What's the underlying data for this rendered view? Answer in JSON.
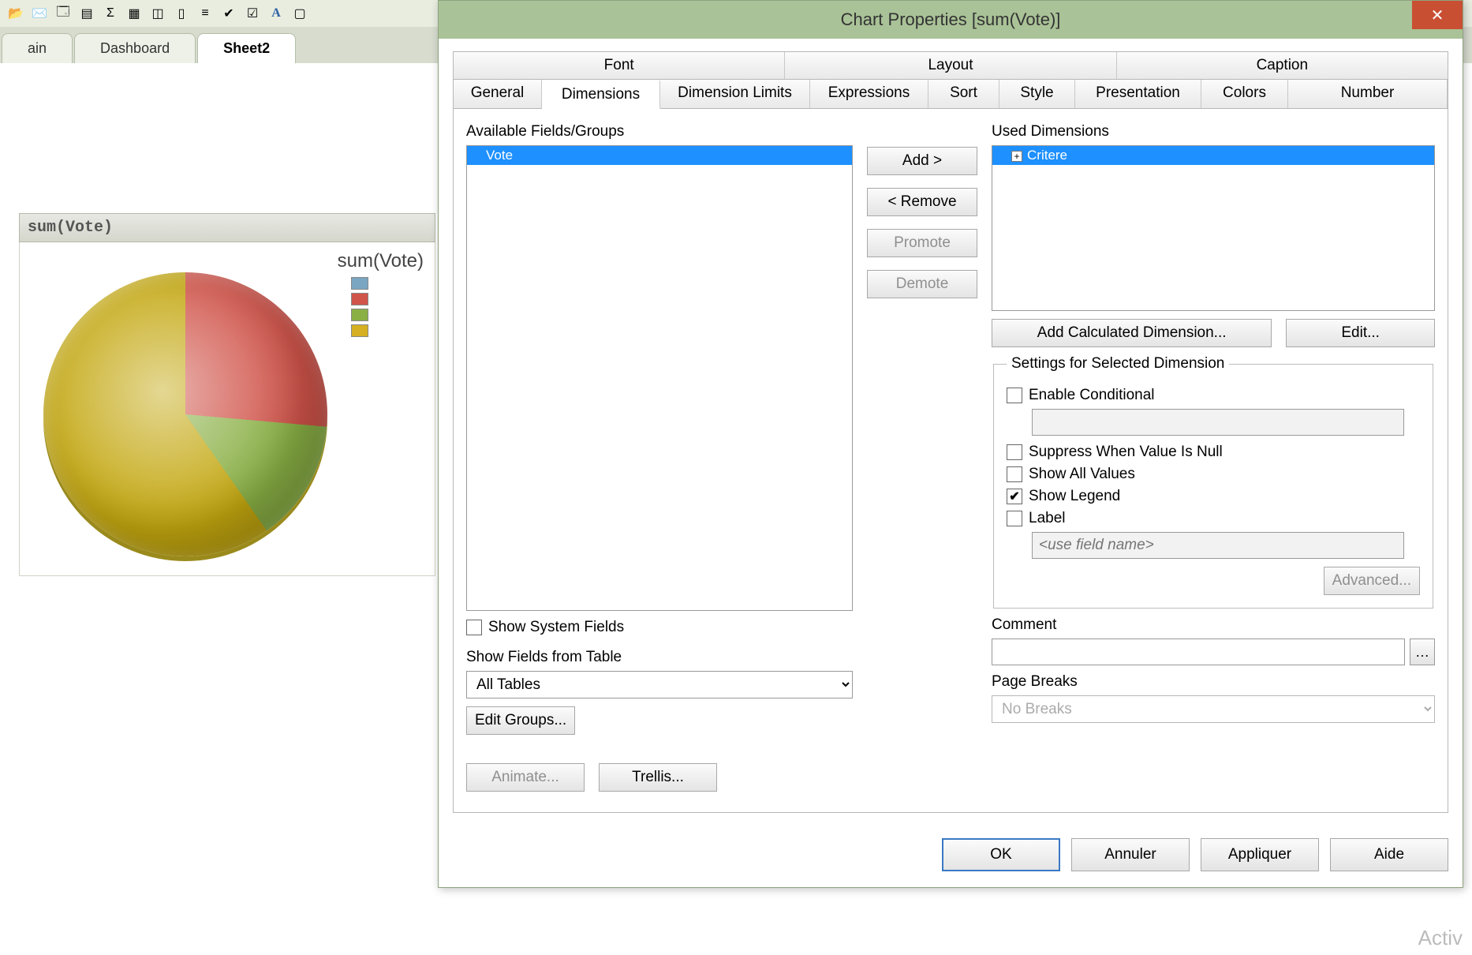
{
  "toolbar_icons": [
    "open-icon",
    "send-icon",
    "new-icon",
    "sheet-icon",
    "sigma-icon",
    "table-icon",
    "chart-icon",
    "bar-icon",
    "line-icon",
    "check-icon",
    "check2-icon",
    "text-icon",
    "box-icon"
  ],
  "sheet_tabs": {
    "items": [
      "ain",
      "Dashboard",
      "Sheet2"
    ],
    "active_index": 2
  },
  "chart": {
    "titlebar": "sum(Vote)",
    "inner_title": "sum(Vote)"
  },
  "chart_data": {
    "type": "pie",
    "title": "sum(Vote)",
    "series": [
      {
        "name": "",
        "color": "#7aa6c2",
        "value": 0
      },
      {
        "name": "",
        "color": "#d0544a",
        "value": 26
      },
      {
        "name": "",
        "color": "#8ab045",
        "value": 14
      },
      {
        "name": "",
        "color": "#d6b023",
        "value": 60
      }
    ],
    "legend_position": "right"
  },
  "dialog": {
    "title": "Chart Properties [sum(Vote)]",
    "upper_tabs": [
      "Font",
      "Layout",
      "Caption"
    ],
    "lower_tabs": [
      "General",
      "Dimensions",
      "Dimension Limits",
      "Expressions",
      "Sort",
      "Style",
      "Presentation",
      "Colors",
      "Number"
    ],
    "active_lower_tab": 1,
    "available_label": "Available Fields/Groups",
    "available_items": [
      "Vote"
    ],
    "available_selected": 0,
    "btns": {
      "add": "Add >",
      "remove": "< Remove",
      "promote": "Promote",
      "demote": "Demote",
      "add_calc": "Add Calculated Dimension...",
      "edit": "Edit...",
      "advanced": "Advanced...",
      "edit_groups": "Edit Groups...",
      "animate": "Animate...",
      "trellis": "Trellis..."
    },
    "show_system_fields_label": "Show System Fields",
    "show_system_fields_checked": false,
    "show_fields_from_table_label": "Show Fields from Table",
    "show_fields_from_table_value": "All Tables",
    "used_label": "Used Dimensions",
    "used_items": [
      "Critere"
    ],
    "used_selected": 0,
    "settings_legend": "Settings for Selected Dimension",
    "enable_conditional_label": "Enable Conditional",
    "enable_conditional_checked": false,
    "suppress_null_label": "Suppress When Value Is Null",
    "suppress_null_checked": false,
    "show_all_values_label": "Show All Values",
    "show_all_values_checked": false,
    "show_legend_label": "Show Legend",
    "show_legend_checked": true,
    "label_label": "Label",
    "label_checked": false,
    "label_placeholder": "<use field name>",
    "comment_label": "Comment",
    "comment_value": "",
    "page_breaks_label": "Page Breaks",
    "page_breaks_value": "No Breaks",
    "footer": {
      "ok": "OK",
      "cancel": "Annuler",
      "apply": "Appliquer",
      "help": "Aide"
    }
  },
  "watermark": "Activ"
}
